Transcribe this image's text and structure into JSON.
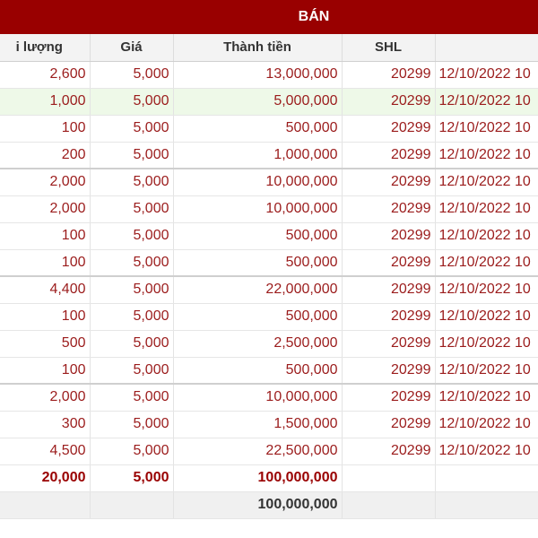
{
  "header": {
    "title": "BÁN"
  },
  "columns": [
    "i lượng",
    "Giá",
    "Thành tiền",
    "SHL",
    ""
  ],
  "rows": [
    {
      "qty": "2,600",
      "price": "5,000",
      "amount": "13,000,000",
      "shl": "20299",
      "date": "12/10/2022 10"
    },
    {
      "qty": "1,000",
      "price": "5,000",
      "amount": "5,000,000",
      "shl": "20299",
      "date": "12/10/2022 10"
    },
    {
      "qty": "100",
      "price": "5,000",
      "amount": "500,000",
      "shl": "20299",
      "date": "12/10/2022 10"
    },
    {
      "qty": "200",
      "price": "5,000",
      "amount": "1,000,000",
      "shl": "20299",
      "date": "12/10/2022 10"
    },
    {
      "qty": "2,000",
      "price": "5,000",
      "amount": "10,000,000",
      "shl": "20299",
      "date": "12/10/2022 10"
    },
    {
      "qty": "2,000",
      "price": "5,000",
      "amount": "10,000,000",
      "shl": "20299",
      "date": "12/10/2022 10"
    },
    {
      "qty": "100",
      "price": "5,000",
      "amount": "500,000",
      "shl": "20299",
      "date": "12/10/2022 10"
    },
    {
      "qty": "100",
      "price": "5,000",
      "amount": "500,000",
      "shl": "20299",
      "date": "12/10/2022 10"
    },
    {
      "qty": "4,400",
      "price": "5,000",
      "amount": "22,000,000",
      "shl": "20299",
      "date": "12/10/2022 10"
    },
    {
      "qty": "100",
      "price": "5,000",
      "amount": "500,000",
      "shl": "20299",
      "date": "12/10/2022 10"
    },
    {
      "qty": "500",
      "price": "5,000",
      "amount": "2,500,000",
      "shl": "20299",
      "date": "12/10/2022 10"
    },
    {
      "qty": "100",
      "price": "5,000",
      "amount": "500,000",
      "shl": "20299",
      "date": "12/10/2022 10"
    },
    {
      "qty": "2,000",
      "price": "5,000",
      "amount": "10,000,000",
      "shl": "20299",
      "date": "12/10/2022 10"
    },
    {
      "qty": "300",
      "price": "5,000",
      "amount": "1,500,000",
      "shl": "20299",
      "date": "12/10/2022 10"
    },
    {
      "qty": "4,500",
      "price": "5,000",
      "amount": "22,500,000",
      "shl": "20299",
      "date": "12/10/2022 10"
    }
  ],
  "total": {
    "qty": "20,000",
    "price": "5,000",
    "amount": "100,000,000"
  },
  "grand_total": {
    "amount": "100,000,000"
  },
  "colors": {
    "header_bg": "#990000",
    "value_text": "#9b1c1c",
    "highlight_row": "#eef9e8"
  }
}
